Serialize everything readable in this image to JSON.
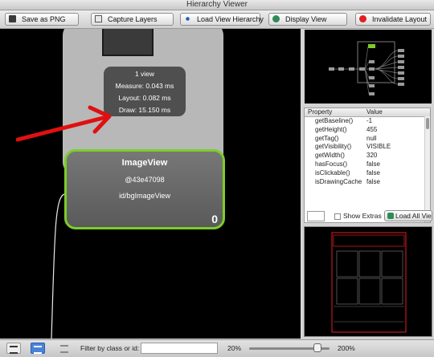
{
  "window": {
    "title": "Hierarchy Viewer"
  },
  "toolbar": {
    "buttons": [
      {
        "label": "Save as PNG",
        "icon": "save-icon"
      },
      {
        "label": "Capture Layers",
        "icon": "capture-icon"
      },
      {
        "label": "Load View Hierarchy",
        "icon": "hierarchy-icon"
      },
      {
        "label": "Display View",
        "icon": "display-icon"
      },
      {
        "label": "Invalidate Layout",
        "icon": "invalidate-icon"
      }
    ]
  },
  "canvas": {
    "stats": {
      "views": "1 view",
      "measure": "Measure: 0.043 ms",
      "layout": "Layout: 0.082 ms",
      "draw": "Draw: 15.150 ms"
    },
    "node": {
      "class_name": "ImageView",
      "hash": "@43e47098",
      "id": "id/bgImageView",
      "index": "0"
    },
    "colors": {
      "node_border": "#7ccd2a",
      "arrow": "#e01010"
    }
  },
  "properties": {
    "header_property": "Property",
    "header_value": "Value",
    "rows": [
      {
        "key": "getBaseline()",
        "value": "-1"
      },
      {
        "key": "getHeight()",
        "value": "455"
      },
      {
        "key": "getTag()",
        "value": "null"
      },
      {
        "key": "getVisibility()",
        "value": "VISIBLE"
      },
      {
        "key": "getWidth()",
        "value": "320"
      },
      {
        "key": "hasFocus()",
        "value": "false"
      },
      {
        "key": "isClickable()",
        "value": "false"
      },
      {
        "key": "isDrawingCache",
        "value": "false"
      }
    ]
  },
  "options": {
    "show_extras": "Show Extras",
    "show_extras_checked": false,
    "load_all": "Load All Vie"
  },
  "statusbar": {
    "filter_label": "Filter by class or id:",
    "filter_value": "",
    "zoom_min": "20%",
    "zoom_max": "200%",
    "zoom_level_fraction": 0.9
  }
}
